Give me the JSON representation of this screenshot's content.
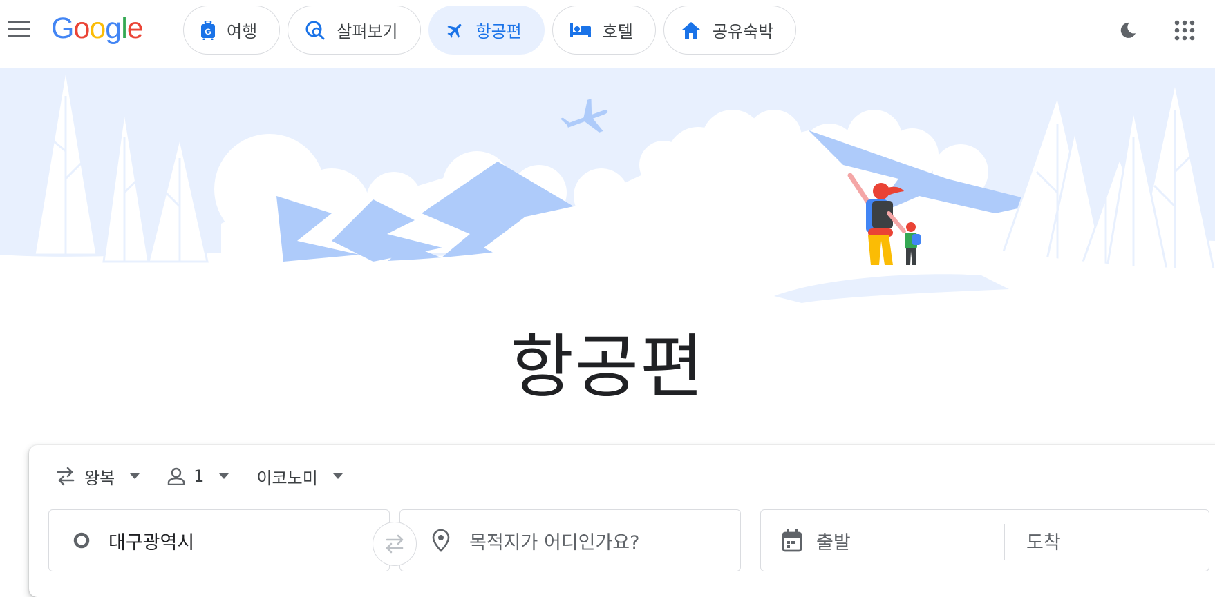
{
  "header": {
    "logo": [
      "G",
      "o",
      "o",
      "g",
      "l",
      "e"
    ],
    "logo_colors": [
      "#4285f4",
      "#ea4335",
      "#fbbc05",
      "#4285f4",
      "#34a853",
      "#ea4335"
    ],
    "nav": [
      {
        "label": "여행",
        "icon": "luggage-icon"
      },
      {
        "label": "살펴보기",
        "icon": "explore-icon"
      },
      {
        "label": "항공편",
        "icon": "airplane-icon",
        "active": true
      },
      {
        "label": "호텔",
        "icon": "bed-icon"
      },
      {
        "label": "공유숙박",
        "icon": "house-icon"
      }
    ]
  },
  "hero": {
    "title": "항공편"
  },
  "search": {
    "trip_type": "왕복",
    "passengers": "1",
    "cabin_class": "이코노미",
    "origin": "대구광역시",
    "destination_placeholder": "목적지가 어디인가요?",
    "depart_placeholder": "출발",
    "return_placeholder": "도착"
  },
  "colors": {
    "accent": "#1a73e8",
    "active_chip_bg": "#e8f0fe",
    "hero_sky": "#e8f0fe",
    "hero_mountain": "#aecbfa"
  }
}
